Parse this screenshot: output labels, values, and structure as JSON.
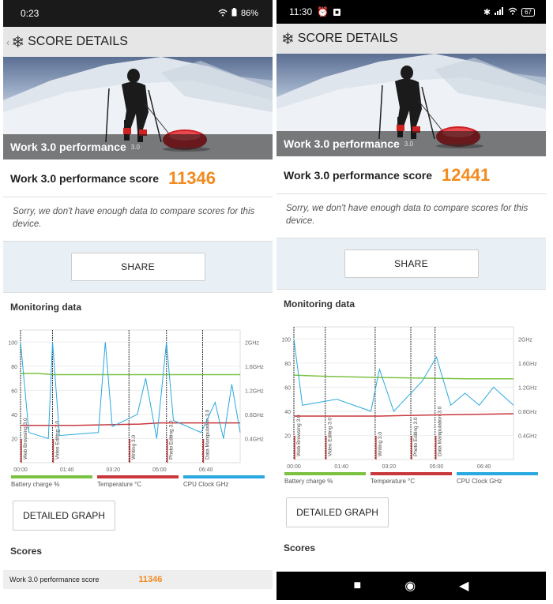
{
  "left": {
    "status": {
      "time": "0:23",
      "battery": "86%"
    },
    "header": {
      "title": "SCORE DETAILS"
    },
    "hero": {
      "label": "Work 3.0 performance",
      "sub": "3.0"
    },
    "score": {
      "label": "Work 3.0 performance score",
      "value": "11346"
    },
    "note": "Sorry, we don't have enough data to compare scores for this device.",
    "share": "SHARE",
    "monitoring": "Monitoring data",
    "detailed": "DETAILED GRAPH",
    "scores_title": "Scores",
    "score_row": {
      "label": "Work 3.0 performance score",
      "value": "11346"
    }
  },
  "right": {
    "status": {
      "time": "11:30",
      "battery": "67"
    },
    "header": {
      "title": "SCORE DETAILS"
    },
    "hero": {
      "label": "Work 3.0 performance",
      "sub": "3.0"
    },
    "score": {
      "label": "Work 3.0 performance score",
      "value": "12441"
    },
    "note": "Sorry, we don't have enough data to compare scores for this device.",
    "share": "SHARE",
    "monitoring": "Monitoring data",
    "detailed": "DETAILED GRAPH",
    "scores_title": "Scores"
  },
  "legend": [
    "Battery charge %",
    "Temperature °C",
    "CPU Clock GHz"
  ],
  "colors": {
    "battery": "#7cc242",
    "temperature": "#c8373c",
    "cpu": "#29a9df",
    "accent": "#f28a1f"
  },
  "chart_data": [
    {
      "type": "line",
      "title": "",
      "x_ticks": [
        "00:00",
        "01:40",
        "03:20",
        "05:00",
        "06:40"
      ],
      "y_left_ticks": [
        "20",
        "40",
        "60",
        "80",
        "100"
      ],
      "y_right_ticks": [
        "0.4GHz",
        "0.8GHz",
        "1.2GHz",
        "1.6GHz",
        "2GHz"
      ],
      "segments": [
        "Web Browsing 3.0",
        "Video Editing 3.0",
        "Writing 3.0",
        "Photo Editing 3.0",
        "Data Manipulation 3.0"
      ],
      "segment_starts_min": [
        0,
        1.15,
        3.9,
        5.25,
        6.55
      ],
      "x_range_min": [
        0,
        7.9
      ],
      "series": [
        {
          "name": "Battery charge %",
          "points": [
            [
              0,
              74
            ],
            [
              0.6,
              74
            ],
            [
              1.2,
              73
            ],
            [
              7.9,
              73
            ]
          ]
        },
        {
          "name": "Temperature °C",
          "points": [
            [
              0,
              31
            ],
            [
              2.0,
              31
            ],
            [
              4.3,
              32
            ],
            [
              5.0,
              33
            ],
            [
              7.9,
              33
            ]
          ]
        },
        {
          "name": "CPU Clock GHz",
          "points": [
            [
              0,
              2.0
            ],
            [
              0.3,
              0.5
            ],
            [
              1.0,
              0.4
            ],
            [
              1.15,
              2.0
            ],
            [
              1.4,
              0.45
            ],
            [
              2.8,
              0.5
            ],
            [
              3.05,
              2.0
            ],
            [
              3.3,
              0.6
            ],
            [
              4.2,
              0.8
            ],
            [
              4.5,
              1.4
            ],
            [
              4.9,
              0.4
            ],
            [
              5.25,
              2.0
            ],
            [
              5.5,
              0.7
            ],
            [
              6.5,
              0.5
            ],
            [
              7.0,
              1.0
            ],
            [
              7.3,
              0.4
            ],
            [
              7.6,
              1.3
            ],
            [
              7.9,
              0.5
            ]
          ]
        }
      ]
    },
    {
      "type": "line",
      "title": "",
      "x_ticks": [
        "00:00",
        "01:40",
        "03:20",
        "05:00",
        "06:40"
      ],
      "y_left_ticks": [
        "20",
        "40",
        "60",
        "80",
        "100"
      ],
      "y_right_ticks": [
        "0.4GHz",
        "0.8GHz",
        "1.2GHz",
        "1.6GHz",
        "2GHz"
      ],
      "segments": [
        "Web Browsing 3.0",
        "Video Editing 3.0",
        "Writing 3.0",
        "Photo Editing 3.0",
        "Data Manipulation 3.0"
      ],
      "segment_starts_min": [
        0,
        1.1,
        2.85,
        4.1,
        4.95
      ],
      "x_range_min": [
        0,
        7.7
      ],
      "series": [
        {
          "name": "Battery charge %",
          "points": [
            [
              0,
              70
            ],
            [
              1.1,
              69
            ],
            [
              3.0,
              68
            ],
            [
              6.0,
              67
            ],
            [
              7.7,
              67
            ]
          ]
        },
        {
          "name": "Temperature °C",
          "points": [
            [
              0,
              36
            ],
            [
              3.0,
              36
            ],
            [
              5.0,
              37
            ],
            [
              7.7,
              38
            ]
          ]
        },
        {
          "name": "CPU Clock GHz",
          "points": [
            [
              0,
              2.0
            ],
            [
              0.3,
              0.9
            ],
            [
              1.5,
              1.0
            ],
            [
              2.7,
              0.8
            ],
            [
              3.0,
              1.5
            ],
            [
              3.5,
              0.8
            ],
            [
              4.5,
              1.3
            ],
            [
              5.0,
              1.7
            ],
            [
              5.5,
              0.9
            ],
            [
              6.0,
              1.1
            ],
            [
              6.5,
              0.9
            ],
            [
              7.0,
              1.2
            ],
            [
              7.7,
              0.9
            ]
          ]
        }
      ]
    }
  ]
}
